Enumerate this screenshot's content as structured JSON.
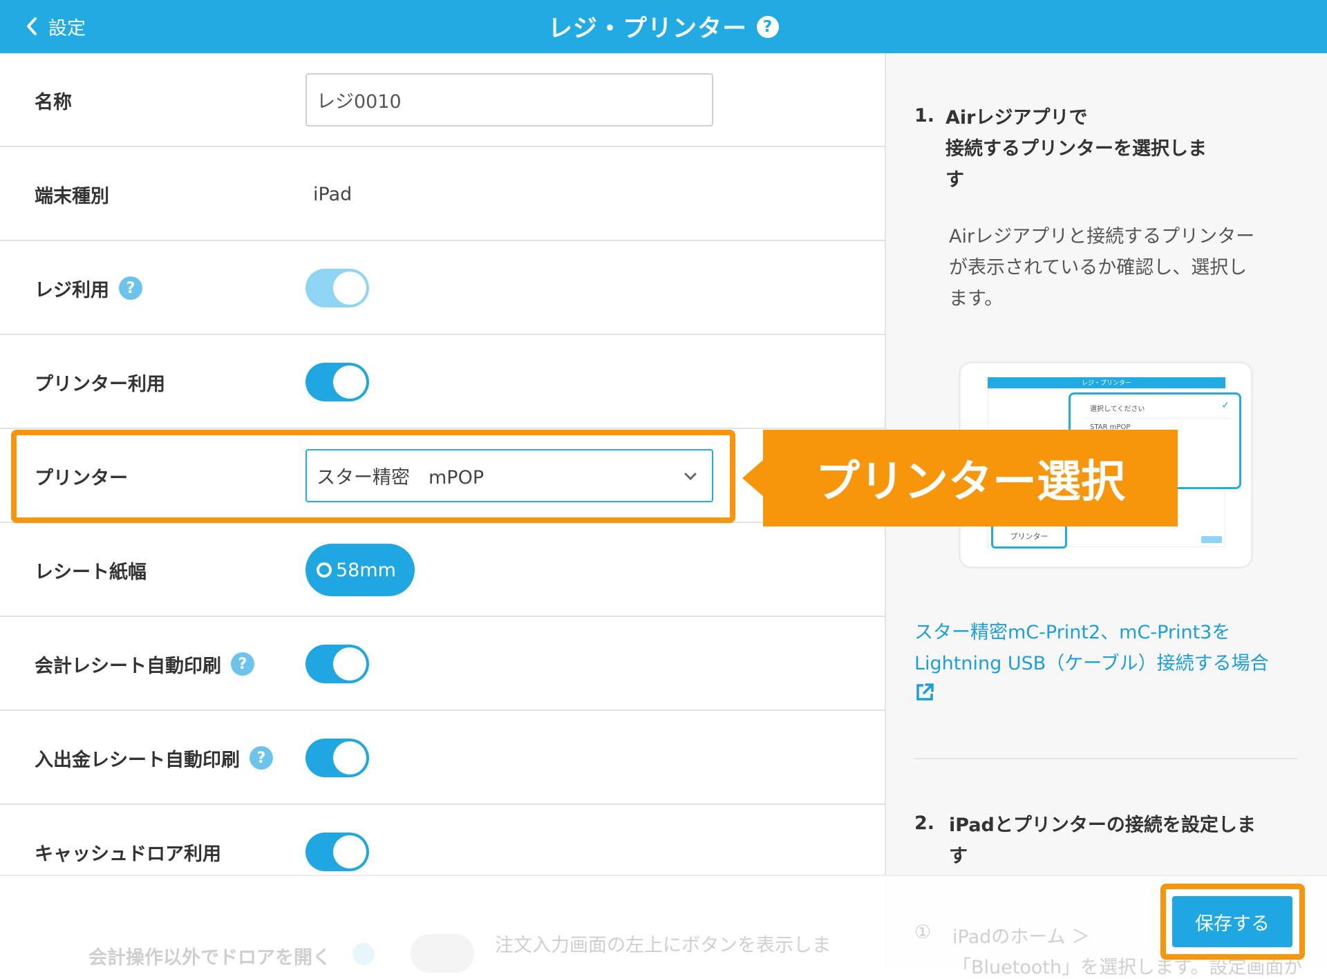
{
  "header": {
    "back_label": "設定",
    "title": "レジ・プリンター"
  },
  "form": {
    "name_label": "名称",
    "name_value": "レジ0010",
    "device_label": "端末種別",
    "device_value": "iPad",
    "register_label": "レジ利用",
    "printer_use_label": "プリンター利用",
    "printer_label": "プリンター",
    "printer_value": "スター精密　mPOP",
    "paper_label": "レシート紙幅",
    "paper_value": "58mm",
    "auto_print_label": "会計レシート自動印刷",
    "cash_print_label": "入出金レシート自動印刷",
    "drawer_label": "キャッシュドロア利用",
    "drawer_open_label": "会計操作以外でドロアを開く",
    "drawer_open_desc": "注文入力画面の左上にボタンを表示しま"
  },
  "callout": "プリンター選択",
  "guide": {
    "step1_num": "1.",
    "step1_title_1": "Airレジアプリで",
    "step1_title_2": "接続するプリンターを選択しま",
    "step1_title_3": "す",
    "step1_desc_1": "Airレジアプリと接続するプリンター",
    "step1_desc_2": "が表示されているか確認し、選択し",
    "step1_desc_3": "ます。",
    "link_1": "スター精密mC-Print2、mC-Print3を",
    "link_2": "Lightning USB（ケーブル）接続する場合",
    "step2_num": "2.",
    "step2_title_1": "iPadとプリンターの接続を設定しま",
    "step2_title_2": "す",
    "step2_sub_num": "①",
    "step2_sub_text": "iPadのホーム ＞",
    "step2_sub_text2": "「Bluetooth」を選択します。設定画面が"
  },
  "mock": {
    "title": "レジ・プリンター",
    "option_1": "選択してください",
    "option_2": "STAR mPOP",
    "field": "プリンター"
  },
  "footer": {
    "save_label": "保存する"
  },
  "colors": {
    "header": "#21abe2",
    "accent": "#1ea7e1",
    "highlight": "#f7960b"
  }
}
